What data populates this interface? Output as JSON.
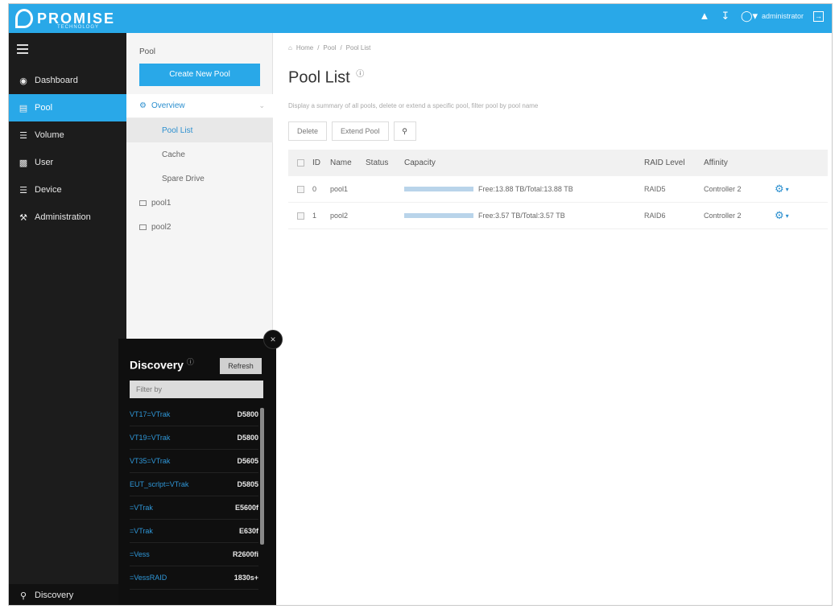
{
  "brand": {
    "name": "PROMISE",
    "sub": "TECHNOLOGY"
  },
  "topbar": {
    "user": "administrator"
  },
  "sidebar": {
    "items": [
      {
        "label": "Dashboard",
        "icon": "dashboard-icon"
      },
      {
        "label": "Pool",
        "icon": "pool-icon",
        "active": true
      },
      {
        "label": "Volume",
        "icon": "volume-icon"
      },
      {
        "label": "User",
        "icon": "user-icon"
      },
      {
        "label": "Device",
        "icon": "device-icon"
      },
      {
        "label": "Administration",
        "icon": "wrench-icon"
      }
    ],
    "discovery_label": "Discovery"
  },
  "subpanel": {
    "title": "Pool",
    "create_label": "Create New Pool",
    "overview": "Overview",
    "children": [
      "Pool List",
      "Cache",
      "Spare Drive"
    ],
    "pools": [
      "pool1",
      "pool2"
    ]
  },
  "discovery": {
    "title": "Discovery",
    "refresh_label": "Refresh",
    "filter_placeholder": "Filter by",
    "items": [
      {
        "name": "VT17=VTrak",
        "model": "D5800"
      },
      {
        "name": "VT19=VTrak",
        "model": "D5800"
      },
      {
        "name": "VT35=VTrak",
        "model": "D5605"
      },
      {
        "name": "EUT_scrlpt=VTrak",
        "model": "D5805"
      },
      {
        "name": "=VTrak",
        "model": "E5600f"
      },
      {
        "name": "=VTrak",
        "model": "E630f"
      },
      {
        "name": "=Vess",
        "model": "R2600fi"
      },
      {
        "name": "=VessRAID",
        "model": "1830s+"
      }
    ]
  },
  "main": {
    "breadcrumb": [
      "Home",
      "/",
      "Pool",
      "/",
      "Pool List"
    ],
    "title": "Pool List",
    "description": "Display a summary of all pools, delete or extend a specific pool, filter pool by pool name",
    "toolbar": {
      "delete": "Delete",
      "extend": "Extend Pool"
    },
    "table": {
      "headers": [
        "ID",
        "Name",
        "Status",
        "Capacity",
        "RAID Level",
        "Affinity"
      ],
      "rows": [
        {
          "id": "0",
          "name": "pool1",
          "status": "",
          "capacity": "Free:13.88 TB/Total:13.88 TB",
          "raid": "RAID5",
          "affinity": "Controller 2"
        },
        {
          "id": "1",
          "name": "pool2",
          "status": "",
          "capacity": "Free:3.57 TB/Total:3.57 TB",
          "raid": "RAID6",
          "affinity": "Controller 2"
        }
      ]
    }
  }
}
